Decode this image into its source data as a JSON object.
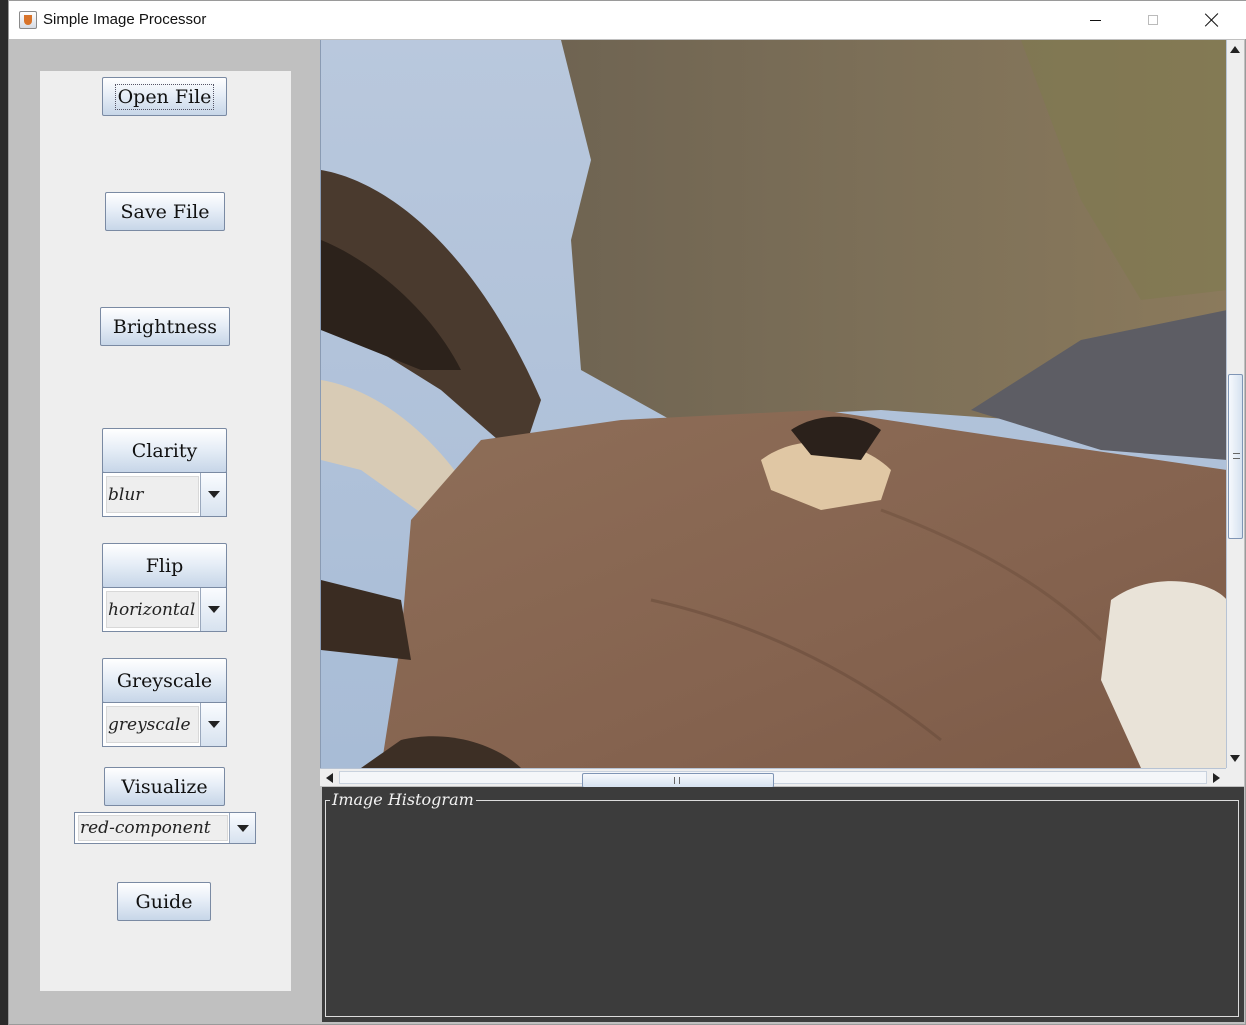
{
  "window": {
    "title": "Simple Image Processor",
    "icon": "java-cup-icon",
    "controls": [
      "minimize-icon",
      "maximize-icon",
      "close-icon"
    ]
  },
  "sidebar": {
    "open_file": "Open File",
    "save_file": "Save File",
    "brightness": "Brightness",
    "clarity": {
      "label": "Clarity",
      "selected": "blur"
    },
    "flip": {
      "label": "Flip",
      "selected": "horizontal"
    },
    "greyscale": {
      "label": "Greyscale",
      "selected": "greyscale"
    },
    "visualize": {
      "label": "Visualize",
      "selected": "red-component"
    },
    "guide": "Guide"
  },
  "histogram": {
    "title": "Image Histogram"
  },
  "colors": {
    "panel_bg": "#eeeeee",
    "outer_bg": "#c0c0c0",
    "histogram_bg": "#3c3c3c"
  }
}
